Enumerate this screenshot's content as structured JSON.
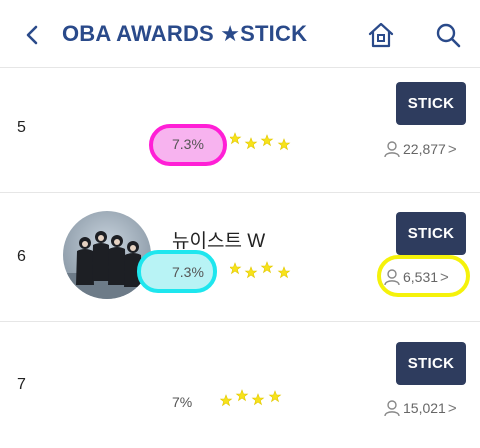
{
  "header": {
    "title": "OBA AWARDS ★STICK",
    "back_icon": "chevron-left-icon",
    "home_icon": "home-icon",
    "search_icon": "search-icon"
  },
  "rows": [
    {
      "rank": "5",
      "name": "",
      "percent": "7.3%",
      "stick_label": "STICK",
      "voters": "22,877",
      "stars": 4
    },
    {
      "rank": "6",
      "name": "뉴이스트 W",
      "percent": "7.3%",
      "stick_label": "STICK",
      "voters": "6,531",
      "stars": 4
    },
    {
      "rank": "7",
      "name": "",
      "percent": "7%",
      "stick_label": "STICK",
      "voters": "15,021",
      "stars": 4
    }
  ],
  "chevron": ">",
  "colors": {
    "title": "#2a4a8a",
    "stick_button": "#2e3c5e",
    "star": "#f7e21a",
    "highlight_pink": "#ff1fd6",
    "highlight_cyan": "#1ee6ee",
    "highlight_yellow": "#f5f20a"
  }
}
